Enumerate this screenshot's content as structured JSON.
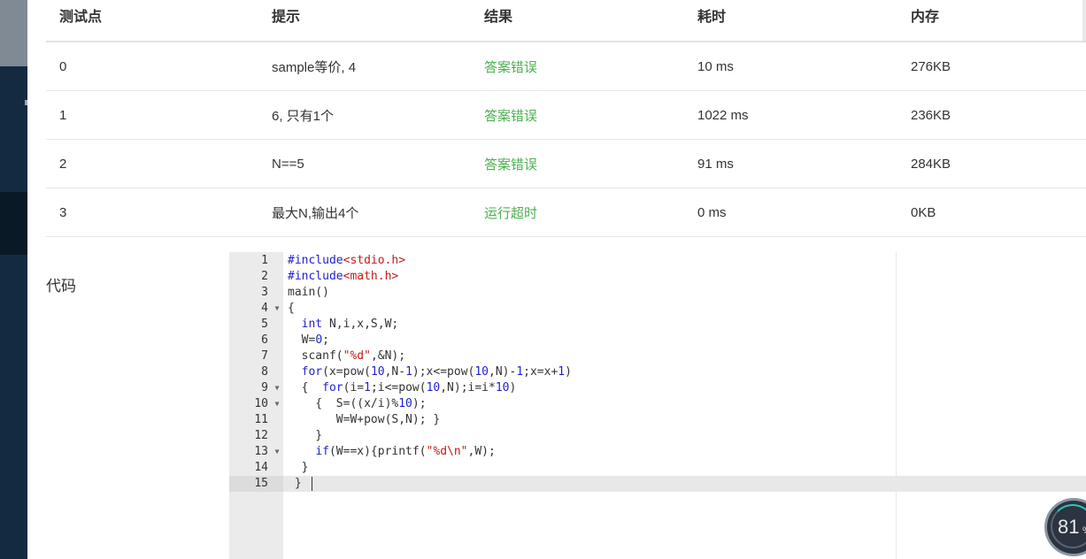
{
  "results_table": {
    "headers": [
      "测试点",
      "提示",
      "结果",
      "耗时",
      "内存"
    ],
    "rows": [
      {
        "id": "0",
        "hint": "sample等价, 4",
        "result": "答案错误",
        "time": "10 ms",
        "memory": "276KB"
      },
      {
        "id": "1",
        "hint": "6, 只有1个",
        "result": "答案错误",
        "time": "1022 ms",
        "memory": "236KB"
      },
      {
        "id": "2",
        "hint": "N==5",
        "result": "答案错误",
        "time": "91 ms",
        "memory": "284KB"
      },
      {
        "id": "3",
        "hint": "最大N,输出4个",
        "result": "运行超时",
        "time": "0 ms",
        "memory": "0KB"
      }
    ]
  },
  "code": {
    "label": "代码",
    "line_numbers": [
      "1",
      "2",
      "3",
      "4",
      "5",
      "6",
      "7",
      "8",
      "9",
      "10",
      "11",
      "12",
      "13",
      "14",
      "15"
    ],
    "lines": [
      "#include<stdio.h>",
      "#include<math.h>",
      "main()",
      "{",
      "  int N,i,x,S,W;",
      "  W=0;",
      "  scanf(\"%d\",&N);",
      "  for(x=pow(10,N-1);x<=pow(10,N)-1;x=x+1)",
      "  {  for(i=1;i<=pow(10,N);i=i*10)",
      "    {  S=((x/i)%10);",
      "       W=W+pow(S,N); }",
      "    }",
      "    if(W==x){printf(\"%d\\n\",W);",
      "  }",
      " }"
    ],
    "active_line": 15
  },
  "score_badge": {
    "value": "81",
    "unit": "%"
  },
  "colors": {
    "status": "#4caf50",
    "sidebar": "#142a40",
    "keyword": "#1f1fd0",
    "string": "#c41a16"
  }
}
